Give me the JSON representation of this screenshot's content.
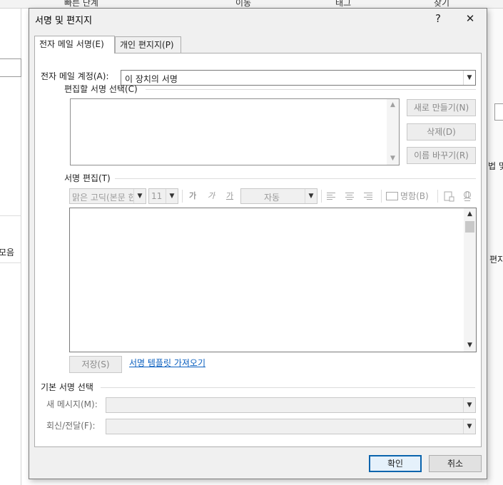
{
  "background": {
    "top_items": [
      "빠른 단계",
      "이동",
      "태그",
      "찾기"
    ],
    "left_label": "모음",
    "right_labels": [
      "법 및",
      "편지"
    ]
  },
  "dialog": {
    "title": "서명 및 편지지",
    "help_label": "?",
    "close_label": "✕",
    "tabs": [
      {
        "label": "전자 메일 서명(E)",
        "active": true
      },
      {
        "label": "개인 편지지(P)",
        "active": false
      }
    ],
    "account_label": "전자 메일 계정(A):",
    "account_value": "이 장치의 서명",
    "select_sig_label": "편집할 서명 선택(C)",
    "buttons_side": {
      "new": "새로 만들기(N)",
      "delete": "삭제(D)",
      "rename": "이름 바꾸기(R)"
    },
    "edit_label": "서명 편집(T)",
    "toolbar": {
      "font": "맑은 고딕(본문 한",
      "size": "11",
      "bold": "가",
      "italic": "가",
      "underline": "가",
      "color": "자동",
      "business_card": "명함(B)"
    },
    "save_label": "저장(S)",
    "template_link": "서명 템플릿 가져오기",
    "default_section_label": "기본 서명 선택",
    "new_messages_label": "새 메시지(M):",
    "reply_label": "회신/전달(F):",
    "ok_label": "확인",
    "cancel_label": "취소"
  },
  "colors": {
    "dialog_bg": "#f0f0f0",
    "link": "#0a5fbf",
    "default_button_border": "#0a64ad"
  }
}
